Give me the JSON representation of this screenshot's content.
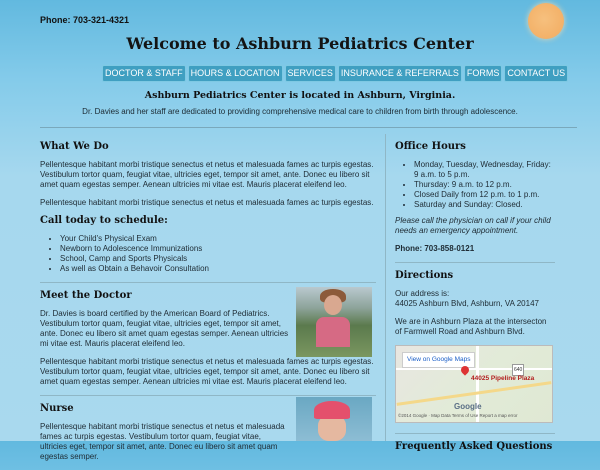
{
  "header": {
    "phone": "Phone: 703-321-4321",
    "title": "Welcome to Ashburn Pediatrics Center",
    "located": "Ashburn Pediatrics Center is located in Ashburn, Virginia.",
    "intro": "Dr. Davies and her staff are dedicated to providing comprehensive medical care to children from birth through adolescence."
  },
  "nav": {
    "items": [
      "DOCTOR & STAFF",
      "HOURS & LOCATION",
      "SERVICES",
      "INSURANCE & REFERRALS",
      "FORMS",
      "CONTACT US"
    ]
  },
  "main": {
    "what_heading": "What We Do",
    "what_p1": "Pellentesque habitant morbi tristique senectus et netus et malesuada fames ac turpis egestas. Vestibulum tortor quam, feugiat vitae, ultricies eget, tempor sit amet, ante. Donec eu libero sit amet quam egestas semper. Aenean ultricies mi vitae est. Mauris placerat eleifend leo.",
    "what_p2": "Pellentesque habitant morbi tristique senectus et netus et malesuada fames ac turpis egestas.",
    "call_heading": "Call today to schedule:",
    "call_items": [
      "Your Child's Physical Exam",
      "Newborn to Adolescence Immunizations",
      "School, Camp and Sports Physicals",
      "As well as Obtain a Behavoir Consultation"
    ],
    "doctor_heading": "Meet the Doctor",
    "doctor_p1": "Dr. Davies is board certified by the American Board of Pediatrics. Vestibulum tortor quam, feugiat vitae, ultricies eget, tempor sit amet, ante. Donec eu libero sit amet quam egestas semper. Aenean ultricies mi vitae est. Mauris placerat eleifend leo.",
    "doctor_p2": "Pellentesque habitant morbi tristique senectus et netus et malesuada fames ac turpis egestas. Vestibulum tortor quam, feugiat vitae, ultricies eget, tempor sit amet, ante. Donec eu libero sit amet quam egestas semper. Aenean ultricies mi vitae est. Mauris placerat eleifend leo.",
    "nurse_heading": "Nurse",
    "nurse_p1": "Pellentesque habitant morbi tristique senectus et netus et malesuada fames ac turpis egestas. Vestibulum tortor quam, feugiat vitae, ultricies eget, tempor sit amet, ante. Donec eu libero sit amet quam egestas semper."
  },
  "sidebar": {
    "hours_heading": "Office Hours",
    "hours": [
      "Monday, Tuesday, Wednesday, Friday: 9 a.m. to 5 p.m.",
      "Thursday: 9 a.m. to 12 p.m.",
      "Closed Daily from 12 p.m. to 1 p.m.",
      "Saturday and Sunday: Closed."
    ],
    "note": "Please call the physician on call if your child needs an emergency appointment.",
    "phone": "Phone: 703-858-0121",
    "directions_heading": "Directions",
    "address_label": "Our address is:",
    "address": "44025 Ashburn Blvd, Ashburn, VA 20147",
    "plaza_text": "We are in Ashburn Plaza at the intersecton of Farmwell Road and Ashburn Blvd.",
    "map_link": "View on Google Maps",
    "map_pin_label": "44025 Pipeline Plaza",
    "map_logo": "Google",
    "map_footer": "©2014 Google · Map Data    Terms of Use    Report a map error",
    "map_badge": "640",
    "faq_heading": "Frequently Asked Questions"
  },
  "colors": {
    "nav_bg": "#3f9fc1",
    "sun": "#f4b36b",
    "background_top": "#62b9df",
    "background_bottom": "#a9d9ee"
  }
}
